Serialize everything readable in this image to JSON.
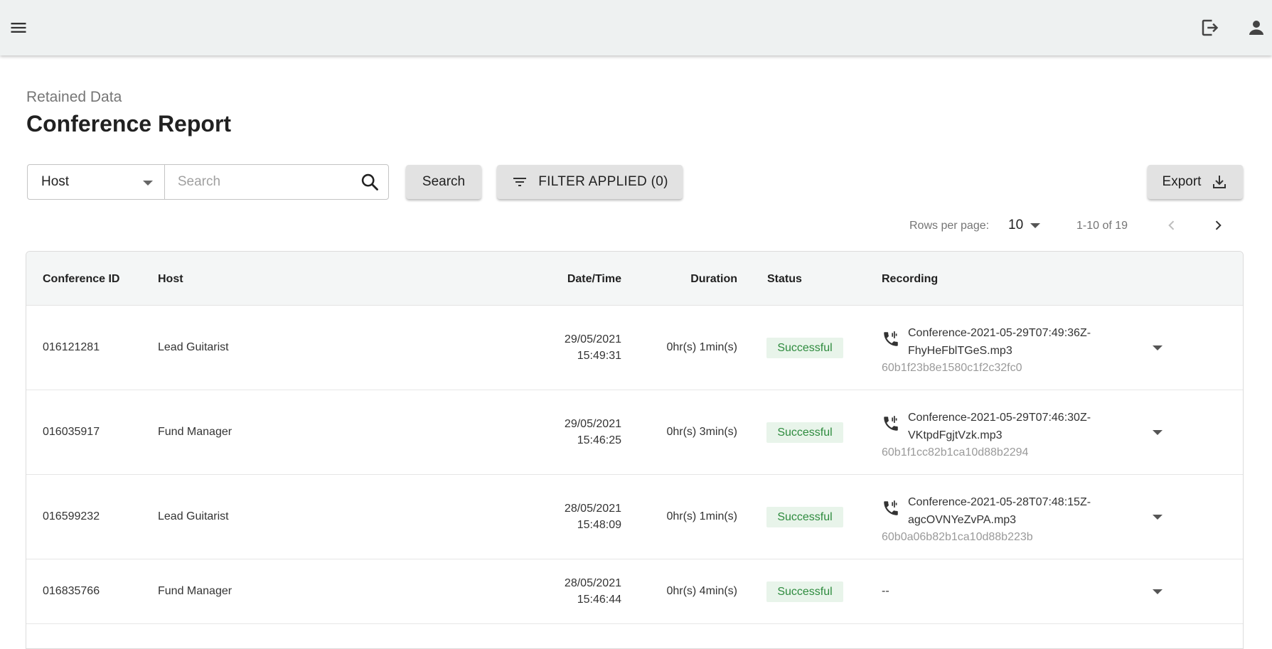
{
  "header": {
    "breadcrumb": "Retained Data",
    "title": "Conference Report"
  },
  "toolbar": {
    "field_select": "Host",
    "search_placeholder": "Search",
    "search_label": "Search",
    "filter_label": "FILTER APPLIED (0)",
    "export_label": "Export"
  },
  "pagination": {
    "rows_label": "Rows per page:",
    "rows_value": "10",
    "range": "1-10 of 19"
  },
  "table": {
    "columns": {
      "id": "Conference ID",
      "host": "Host",
      "datetime": "Date/Time",
      "duration": "Duration",
      "status": "Status",
      "recording": "Recording"
    },
    "rows": [
      {
        "id": "016121281",
        "host": "Lead Guitarist",
        "date": "29/05/2021",
        "time": "15:49:31",
        "duration": "0hr(s) 1min(s)",
        "status": "Successful",
        "rec_line1": "Conference-2021-05-29T07:49:36Z-",
        "rec_line2": "FhyHeFblTGeS.mp3",
        "rec_hash": "60b1f23b8e1580c1f2c32fc0"
      },
      {
        "id": "016035917",
        "host": "Fund Manager",
        "date": "29/05/2021",
        "time": "15:46:25",
        "duration": "0hr(s) 3min(s)",
        "status": "Successful",
        "rec_line1": "Conference-2021-05-29T07:46:30Z-",
        "rec_line2": "VKtpdFgjtVzk.mp3",
        "rec_hash": "60b1f1cc82b1ca10d88b2294"
      },
      {
        "id": "016599232",
        "host": "Lead Guitarist",
        "date": "28/05/2021",
        "time": "15:48:09",
        "duration": "0hr(s) 1min(s)",
        "status": "Successful",
        "rec_line1": "Conference-2021-05-28T07:48:15Z-",
        "rec_line2": "agcOVNYeZvPA.mp3",
        "rec_hash": "60b0a06b82b1ca10d88b223b"
      },
      {
        "id": "016835766",
        "host": "Fund Manager",
        "date": "28/05/2021",
        "time": "15:46:44",
        "duration": "0hr(s) 4min(s)",
        "status": "Successful",
        "rec_none": "--"
      }
    ]
  },
  "icons": {
    "menu": "menu-icon",
    "logout": "logout-icon",
    "user": "user-icon",
    "search": "search-icon",
    "filter": "filter-icon",
    "export": "download-icon",
    "recording": "phone-recording-icon"
  },
  "colors": {
    "topbar": "#eef1f1",
    "success_bg": "#e8f4ea",
    "success_text": "#2e8b3e"
  }
}
